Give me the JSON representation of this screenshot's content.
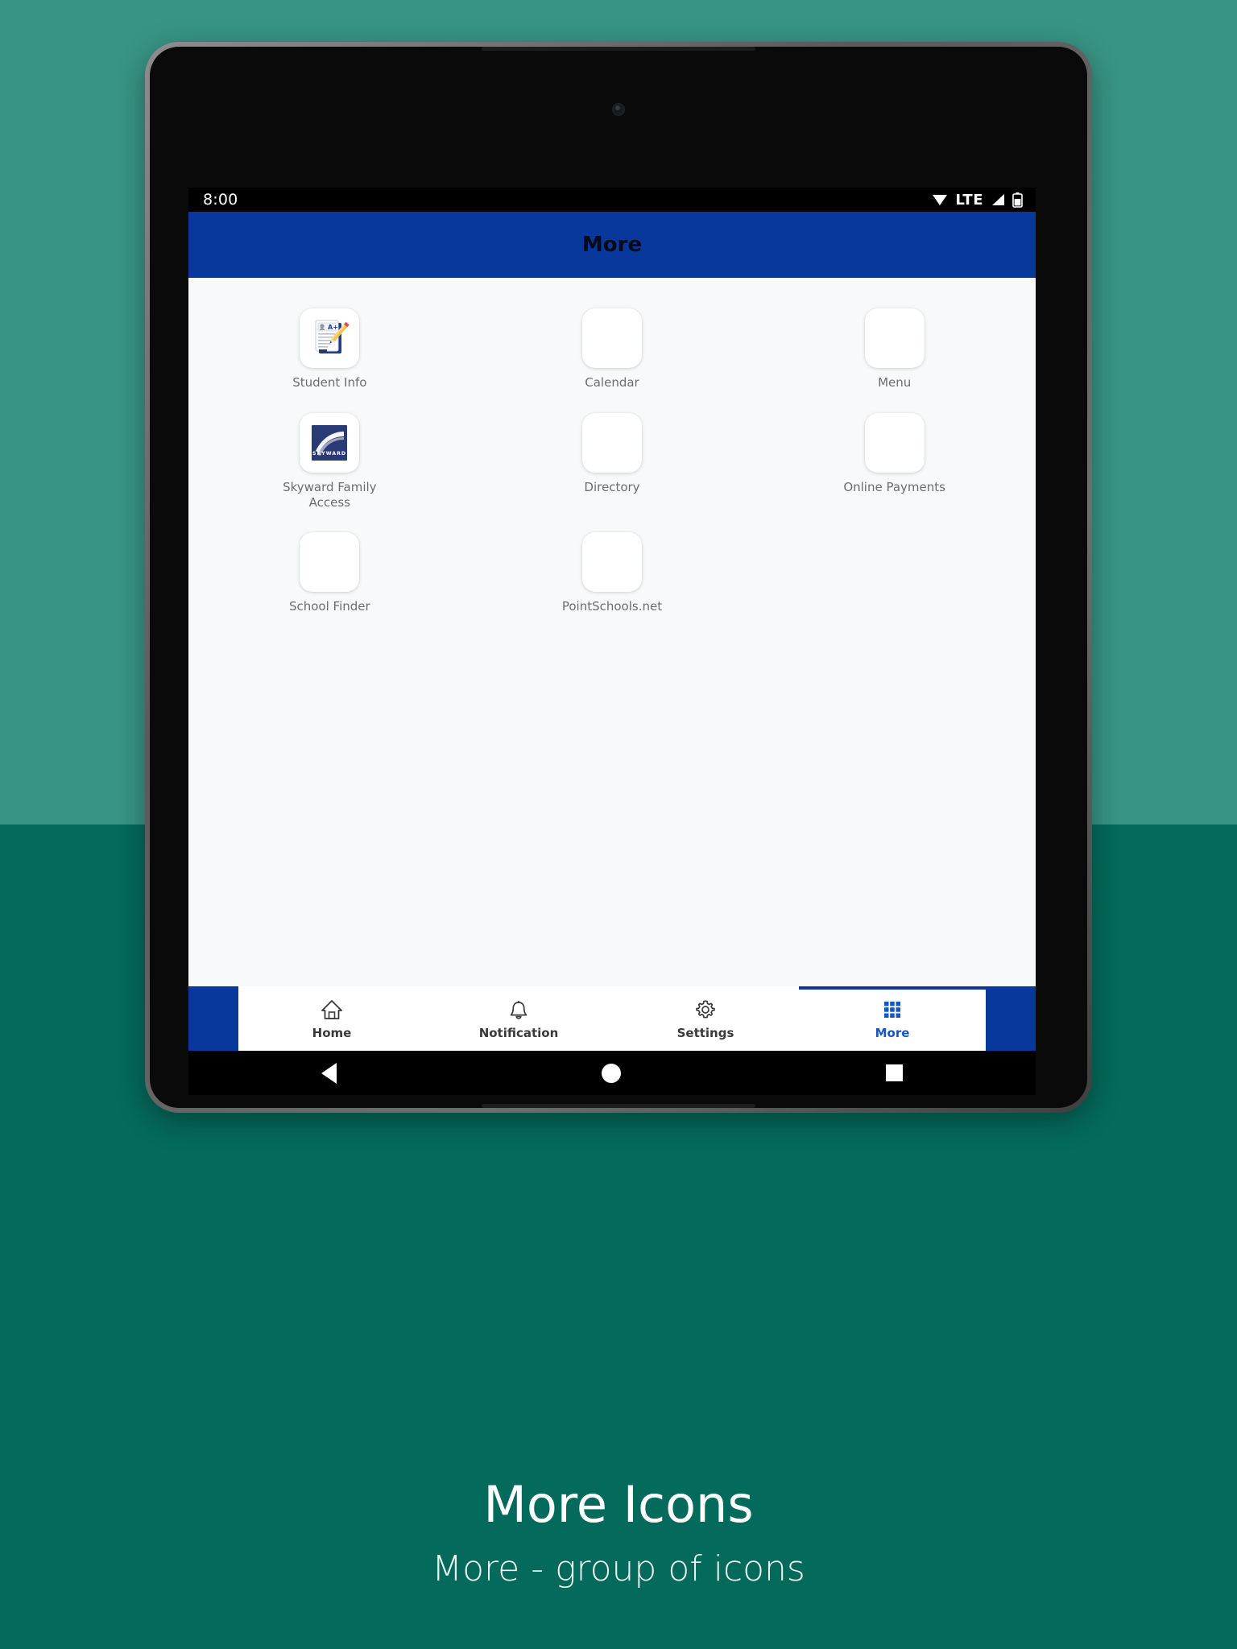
{
  "background": {
    "top_color": "#389484",
    "bottom_color": "#046a5b"
  },
  "device": {
    "type": "android-tablet",
    "frame_color": "#5a5a5a"
  },
  "status_bar": {
    "time": "8:00",
    "icons": [
      "wifi-icon",
      "lte-label",
      "signal-icon",
      "battery-icon"
    ],
    "lte_label": "LTE",
    "background": "#000000"
  },
  "app_bar": {
    "title": "More",
    "background": "#09389c",
    "title_color": "#050a18"
  },
  "grid": {
    "items": [
      {
        "label": "Student Info",
        "icon": "student-info-icon",
        "has_artwork": true
      },
      {
        "label": "Calendar",
        "icon": "calendar-icon",
        "has_artwork": false
      },
      {
        "label": "Menu",
        "icon": "menu-icon",
        "has_artwork": false
      },
      {
        "label": "Skyward Family Access",
        "icon": "skyward-icon",
        "has_artwork": true
      },
      {
        "label": "Directory",
        "icon": "directory-icon",
        "has_artwork": false
      },
      {
        "label": "Online Payments",
        "icon": "online-payments-icon",
        "has_artwork": false
      },
      {
        "label": "School Finder",
        "icon": "school-finder-icon",
        "has_artwork": false
      },
      {
        "label": "PointSchools.net",
        "icon": "pointschools-icon",
        "has_artwork": false
      }
    ]
  },
  "student_info_icon": {
    "grade_text": "A+"
  },
  "skyward_icon": {
    "wordmark": "SKYWARD",
    "background": "#2a3a77"
  },
  "bottom_nav": {
    "active_color": "#1556c0",
    "inactive_color": "#3a3a3a",
    "items": [
      {
        "label": "Home",
        "icon": "home-icon",
        "active": false
      },
      {
        "label": "Notification",
        "icon": "bell-icon",
        "active": false
      },
      {
        "label": "Settings",
        "icon": "gear-icon",
        "active": false
      },
      {
        "label": "More",
        "icon": "grid-more-icon",
        "active": true
      }
    ]
  },
  "android_nav": {
    "buttons": [
      "back-icon",
      "home-circle-icon",
      "recents-square-icon"
    ]
  },
  "caption": {
    "title": "More Icons",
    "subtitle": "More - group of icons"
  }
}
